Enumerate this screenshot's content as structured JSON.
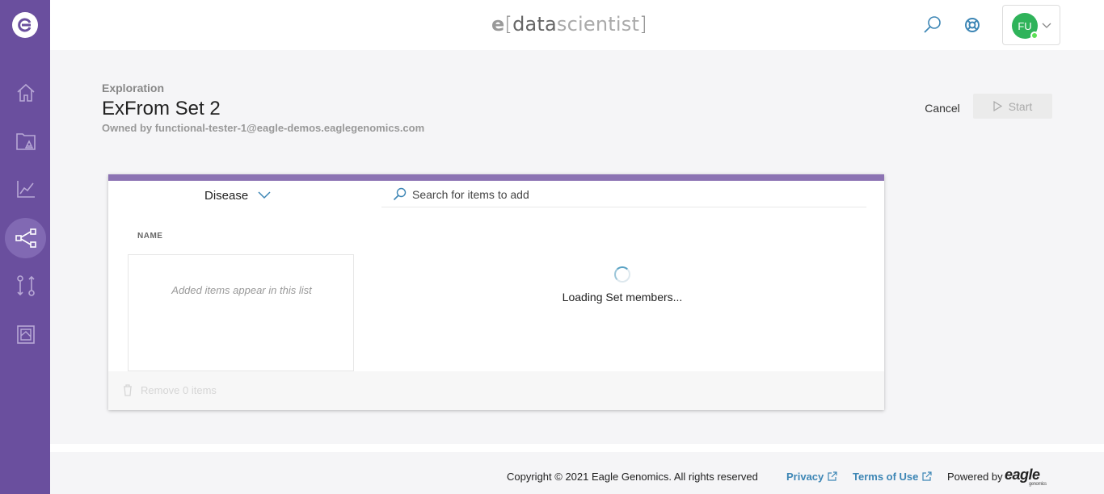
{
  "app": {
    "brand_e": "e",
    "brand_open": "[",
    "brand_data": "data",
    "brand_scientist": "scientist",
    "brand_close": "]"
  },
  "user": {
    "initials": "FU"
  },
  "sidebar": {
    "items": [
      {
        "name": "home-icon"
      },
      {
        "name": "catalogue-icon"
      },
      {
        "name": "chart-icon"
      },
      {
        "name": "exploration-icon",
        "active": true
      },
      {
        "name": "workflow-icon"
      },
      {
        "name": "gallery-icon"
      }
    ]
  },
  "page": {
    "breadcrumb": "Exploration",
    "title": "ExFrom Set 2",
    "owner": "Owned by functional-tester-1@eagle-demos.eaglegenomics.com",
    "cancel_label": "Cancel",
    "start_label": "Start"
  },
  "editor": {
    "type_selected": "Disease",
    "search_placeholder": "Search for items to add",
    "column_name": "NAME",
    "empty_list_text": "Added items appear in this list",
    "loading_text": "Loading Set members...",
    "remove_label": "Remove 0 items"
  },
  "footer": {
    "copyright": "Copyright © 2021 Eagle Genomics. All rights reserved",
    "privacy": "Privacy",
    "terms": "Terms of Use",
    "powered": "Powered by",
    "logo_text": "eagle",
    "logo_sub": "genomics"
  },
  "colors": {
    "sidebar": "#6a4f9e",
    "accent_bar": "#8c73b3",
    "link": "#3d86b5",
    "avatar": "#2fb35a"
  }
}
